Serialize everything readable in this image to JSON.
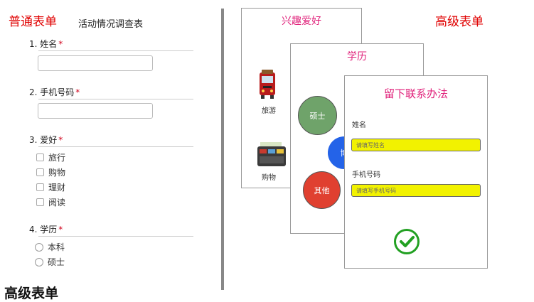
{
  "left": {
    "title": "普通表单",
    "subtitle": "活动情况调查表",
    "required_mark": "*",
    "q1": {
      "label": "1. 姓名"
    },
    "q2": {
      "label": "2. 手机号码"
    },
    "q3": {
      "label": "3. 爱好",
      "options": [
        "旅行",
        "购物",
        "理财",
        "阅读"
      ]
    },
    "q4": {
      "label": "4. 学历",
      "options": [
        "本科",
        "硕士"
      ]
    },
    "bottom_cut_title": "高级表单"
  },
  "right": {
    "title": "高级表单",
    "card_hobby": {
      "title": "兴趣爱好",
      "items": [
        "旅游",
        "购物"
      ]
    },
    "card_edu": {
      "title": "学历",
      "circles": [
        "硕士",
        "博",
        "其他"
      ]
    },
    "card_contact": {
      "title": "留下联系办法",
      "name_label": "姓名",
      "name_placeholder": "请填写姓名",
      "phone_label": "手机号码",
      "phone_placeholder": "请填写手机号码"
    }
  },
  "colors": {
    "accent_red": "#e00000",
    "pink": "#e0207a",
    "yellow_input": "#f2f200",
    "green_check": "#22a022"
  }
}
